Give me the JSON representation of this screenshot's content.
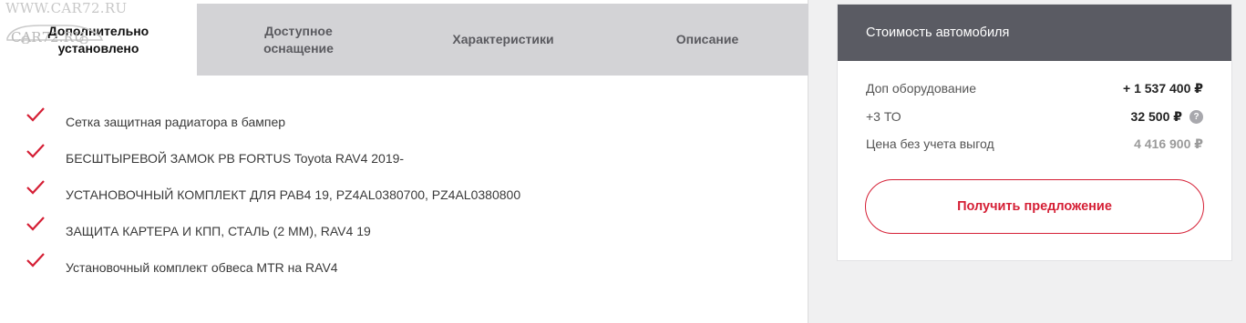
{
  "watermark": {
    "top": "WWW.CAR72.RU",
    "logo": "CAR72.RU"
  },
  "tabs": [
    {
      "label_line1": "Дополнительно",
      "label_line2": "установлено",
      "active": true
    },
    {
      "label_line1": "Доступное",
      "label_line2": "оснащение",
      "active": false
    },
    {
      "label_line1": "Характеристики",
      "label_line2": "",
      "active": false
    },
    {
      "label_line1": "Описание",
      "label_line2": "",
      "active": false
    }
  ],
  "items": [
    {
      "text": "Сетка защитная радиатора в бампер",
      "icon": "check-icon"
    },
    {
      "text": "БЕСШТЫРЕВОЙ ЗАМОК PB FORTUS Toyota RAV4 2019-",
      "icon": "check-icon"
    },
    {
      "text": "УСТАНОВОЧНЫЙ КОМПЛЕКТ ДЛЯ РАВ4 19, PZ4AL0380700, PZ4AL0380800",
      "icon": "check-icon"
    },
    {
      "text": "ЗАЩИТА КАРТЕРА И КПП, СТАЛЬ (2 ММ), RAV4 19",
      "icon": "check-icon"
    },
    {
      "text": "Установочный комплект обвеса MTR на RAV4",
      "icon": "check-icon"
    }
  ],
  "price_panel": {
    "title": "Стоимость автомобиля",
    "rows": [
      {
        "label": "Доп оборудование",
        "value": "+ 1 537 400 ₽"
      },
      {
        "label": "+3 ТО",
        "value": "32 500 ₽",
        "help": "?"
      },
      {
        "label": "Цена без учета выгод",
        "value": "4 416 900 ₽"
      }
    ],
    "button_label": "Получить предложение"
  },
  "colors": {
    "accent": "#d51f35",
    "header_bg": "#5a5b63",
    "tabs_bg": "#d3d3d6",
    "page_bg": "#f0f0f1"
  }
}
